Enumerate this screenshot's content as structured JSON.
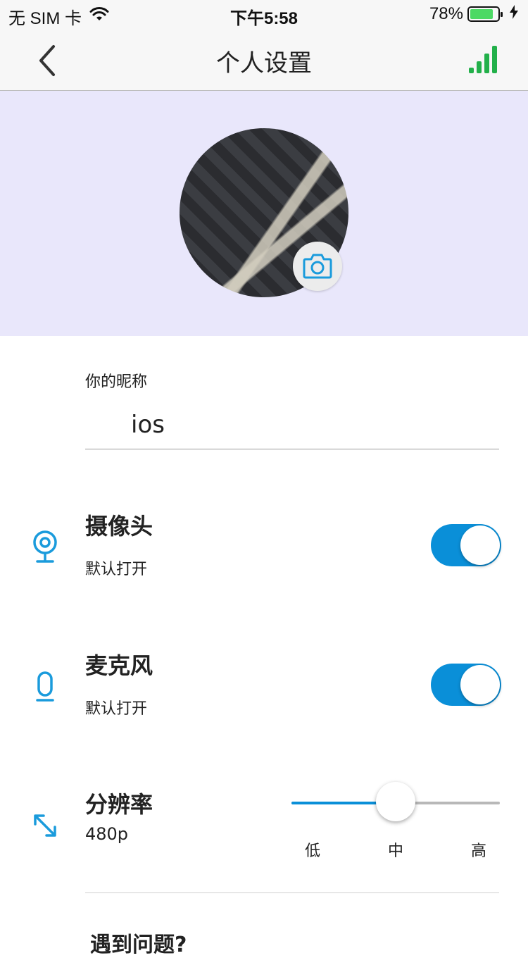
{
  "status_bar": {
    "carrier": "无 SIM 卡",
    "time": "下午5:58",
    "battery_percent": "78%",
    "battery_level": 0.78,
    "battery_color": "#4cd964"
  },
  "nav": {
    "title": "个人设置",
    "back_icon": "chevron-left-icon",
    "right_icon": "signal-bars-icon",
    "signal_color": "#22b04a"
  },
  "profile": {
    "background_color": "#e9e7fb",
    "camera_icon": "camera-icon"
  },
  "nickname": {
    "label": "你的昵称",
    "value": "ios"
  },
  "settings": {
    "camera": {
      "title": "摄像头",
      "subtitle": "默认打开",
      "enabled": true,
      "icon": "webcam-icon"
    },
    "microphone": {
      "title": "麦克风",
      "subtitle": "默认打开",
      "enabled": true,
      "icon": "microphone-icon"
    },
    "resolution": {
      "title": "分辨率",
      "value": "480p",
      "icon": "resize-icon",
      "slider_level": 0.5,
      "options": [
        "低",
        "中",
        "高"
      ]
    }
  },
  "help": {
    "title": "遇到问题?"
  },
  "colors": {
    "accent": "#0a8fd8"
  }
}
